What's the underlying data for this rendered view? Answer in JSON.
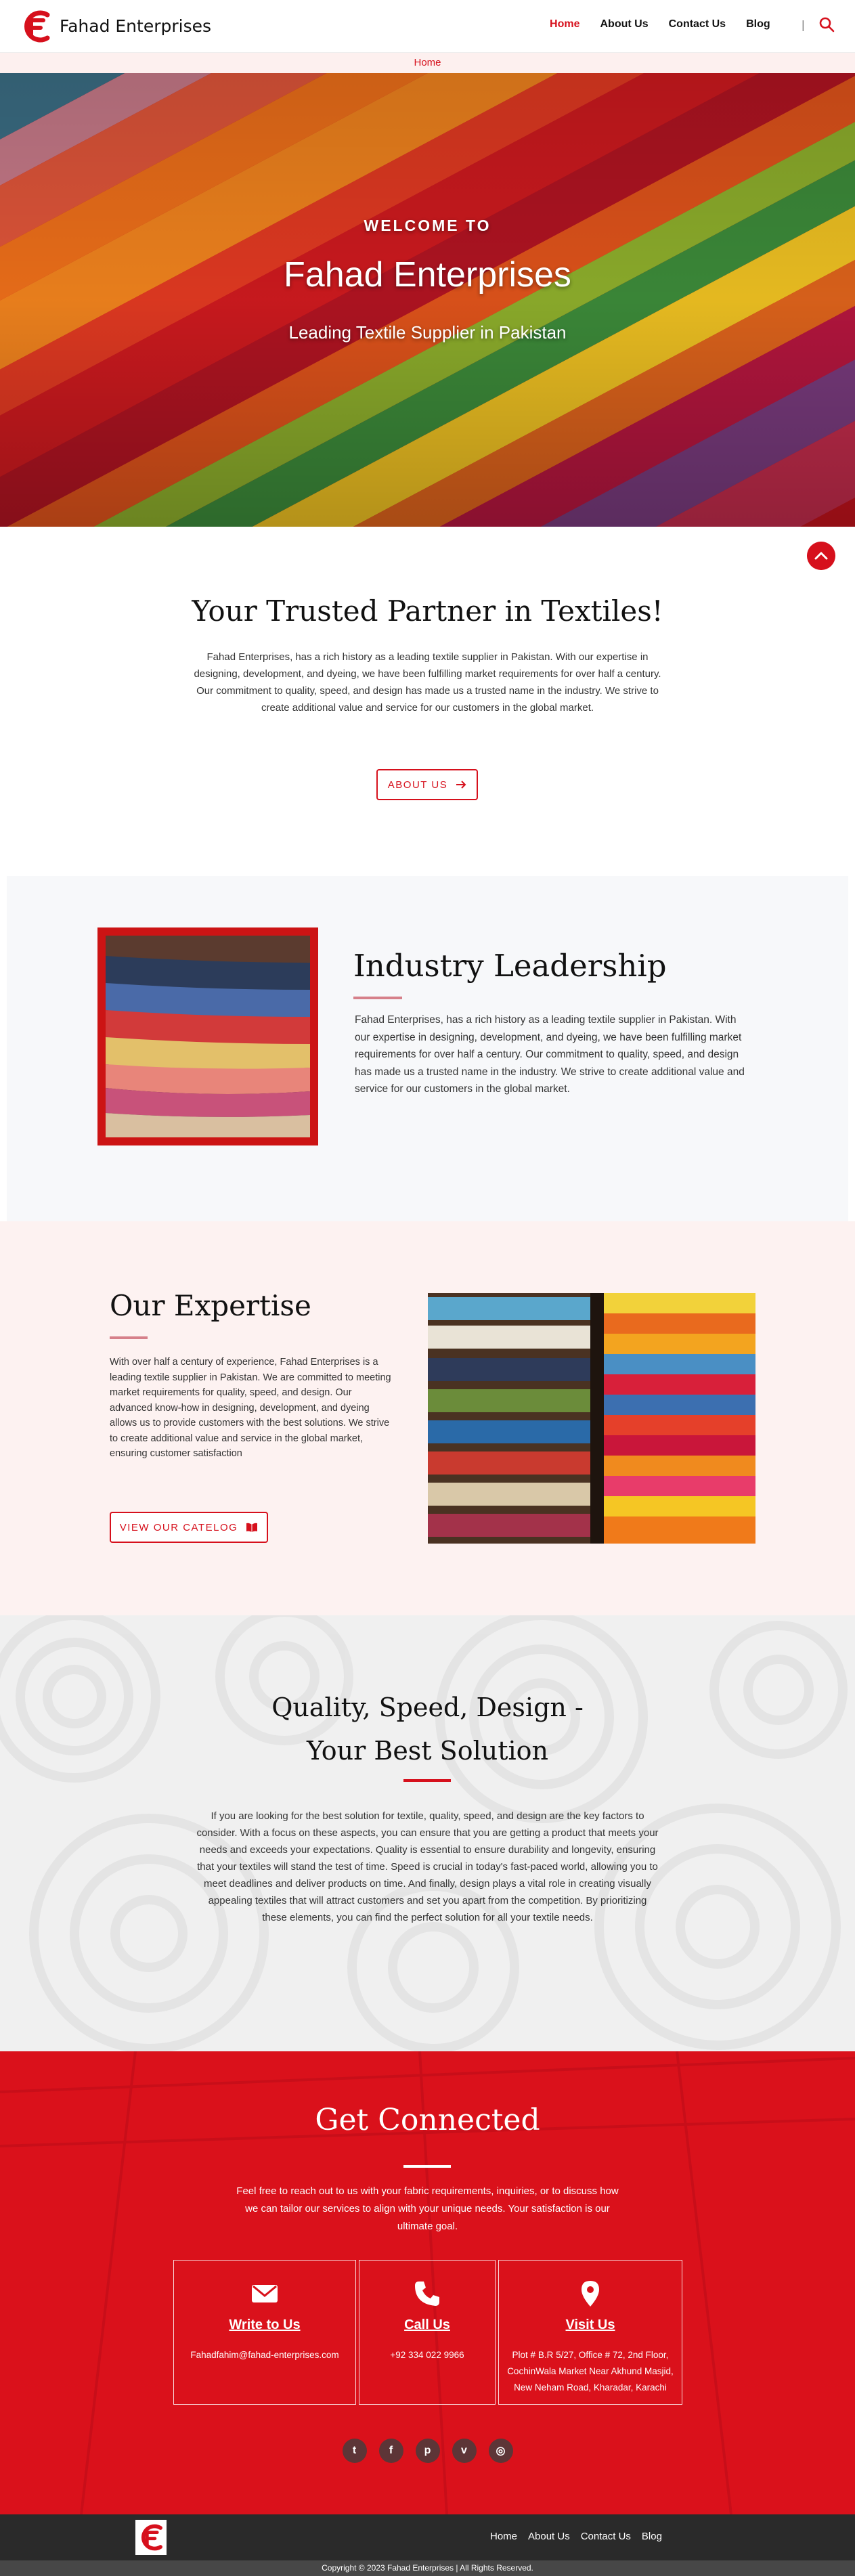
{
  "header": {
    "brand": "Fahad Enterprises",
    "nav": [
      "Home",
      "About Us",
      "Contact Us",
      "Blog"
    ],
    "separator": "|"
  },
  "breadcrumb": "Home",
  "hero": {
    "eyebrow": "WELCOME TO",
    "title": "Fahad Enterprises",
    "subtitle": "Leading Textile Supplier in Pakistan"
  },
  "trusted": {
    "title": "Your Trusted Partner in Textiles!",
    "text": "Fahad Enterprises, has a rich history as a leading textile supplier in Pakistan. With our expertise in designing, development, and dyeing, we have been fulfilling market requirements for over half a century. Our commitment to quality, speed, and design has made us a trusted name in the industry. We strive to create additional value and service for our customers in the global market.",
    "button": "ABOUT US"
  },
  "leadership": {
    "title": "Industry Leadership",
    "text": "Fahad Enterprises, has a rich history as a leading textile supplier in Pakistan. With our expertise in designing, development, and dyeing, we have been fulfilling market requirements for over half a century. Our commitment to quality, speed, and design has made us a trusted name in the industry. We strive to create additional value and service for our customers in the global market."
  },
  "expertise": {
    "title": "Our Expertise",
    "text": "With over half a century of experience, Fahad Enterprises is a leading textile supplier in Pakistan. We are committed to meeting market requirements for quality, speed, and design. Our advanced know-how in designing, development, and dyeing allows us to provide customers with the best solutions. We strive to create additional value and service in the global market, ensuring customer satisfaction",
    "button": "VIEW OUR CATELOG"
  },
  "quality": {
    "title_line1": "Quality, Speed, Design -",
    "title_line2": "Your Best Solution",
    "text": "If you are looking for the best solution for textile, quality, speed, and design are the key factors to consider. With a focus on these aspects, you can ensure that you are getting a product that meets your needs and exceeds your expectations. Quality is essential to ensure durability and longevity, ensuring that your textiles will stand the test of time. Speed is crucial in today's fast-paced world, allowing you to meet deadlines and deliver products on time. And finally, design plays a vital role in creating visually appealing textiles that will attract customers and set you apart from the competition. By prioritizing these elements, you can find the perfect solution for all your textile needs."
  },
  "connect": {
    "title": "Get Connected",
    "text": "Feel free to reach out to us with your fabric requirements, inquiries, or to discuss how we can tailor our services to align with your unique needs. Your satisfaction is our ultimate goal.",
    "cards": [
      {
        "title": "Write to Us",
        "value": "Fahadfahim@fahad-enterprises.com",
        "icon": "envelope-icon"
      },
      {
        "title": "Call Us",
        "value": "+92 334 022 9966",
        "icon": "phone-icon"
      },
      {
        "title": "Visit Us",
        "value": "Plot # B.R 5/27, Office # 72, 2nd Floor, CochinWala Market Near Akhund Masjid, New Neham Road, Kharadar, Karachi",
        "icon": "location-pin-icon"
      }
    ],
    "socials": [
      {
        "name": "twitter-icon",
        "glyph": "t"
      },
      {
        "name": "facebook-icon",
        "glyph": "f"
      },
      {
        "name": "pinterest-icon",
        "glyph": "p"
      },
      {
        "name": "vimeo-icon",
        "glyph": "v"
      },
      {
        "name": "instagram-icon",
        "glyph": "◎"
      }
    ]
  },
  "footer": {
    "nav": [
      "Home",
      "About Us",
      "Contact Us",
      "Blog"
    ],
    "copyright": "Copyright © 2023 Fahad Enterprises | All Rights Reserved."
  },
  "colors": {
    "accent": "#d6101c",
    "connect_bg": "#d8101a",
    "footer_bg": "#2a2a2a",
    "leadership_bg": "#f7f8fa",
    "expertise_bg": "#fdf2f1"
  }
}
